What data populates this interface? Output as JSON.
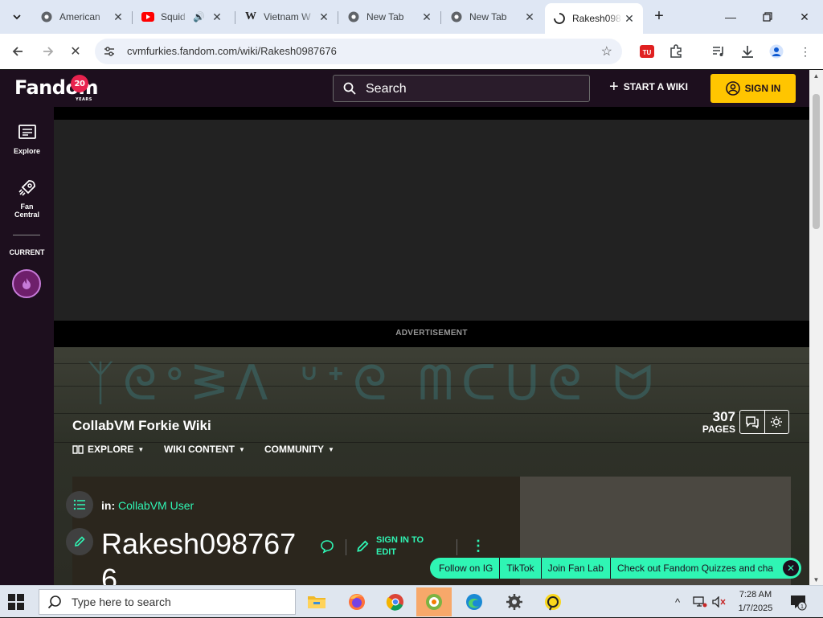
{
  "browser": {
    "tabs": [
      {
        "title": "American",
        "favicon": "chrome-icon",
        "active": false
      },
      {
        "title": "Squid",
        "favicon": "youtube-icon",
        "active": false,
        "audio": true
      },
      {
        "title": "Vietnam W",
        "favicon": "wikipedia-icon",
        "active": false
      },
      {
        "title": "New Tab",
        "favicon": "chrome-icon",
        "active": false
      },
      {
        "title": "New Tab",
        "favicon": "chrome-icon",
        "active": false
      },
      {
        "title": "Rakesh098",
        "favicon": "loading-icon",
        "active": true
      }
    ],
    "url": "cvmfurkies.fandom.com/wiki/Rakesh0987676"
  },
  "fandom": {
    "logo_text": "Fandom",
    "logo_badge": "20",
    "logo_years": "YEARS",
    "search_placeholder": "Search",
    "start_wiki": "START A WIKI",
    "sign_in": "SIGN IN",
    "rail": {
      "explore": "Explore",
      "fan_central": "Fan Central",
      "current": "CURRENT"
    },
    "ad_label": "ADVERTISEMENT"
  },
  "wiki": {
    "name": "CollabVM Forkie Wiki",
    "nav": [
      "EXPLORE",
      "WIKI CONTENT",
      "COMMUNITY"
    ],
    "pages_count": "307",
    "pages_label": "PAGES"
  },
  "article": {
    "in_label": "in:",
    "category": "CollabVM User",
    "title": "Rakesh0987676",
    "sign_in_to_edit": "SIGN IN TO EDIT"
  },
  "follow_bar": {
    "items": [
      "Follow on IG",
      "TikTok",
      "Join Fan Lab",
      "Check out Fandom Quizzes and cha"
    ]
  },
  "taskbar": {
    "search_placeholder": "Type here to search",
    "time": "7:28 AM",
    "date": "1/7/2025",
    "notification_count": "1"
  },
  "colors": {
    "fandom_dark": "#1d0f1e",
    "accent_green": "#2ff5b4",
    "sign_in_yellow": "#ffc500",
    "taskbar_active": "#f7a86a"
  }
}
